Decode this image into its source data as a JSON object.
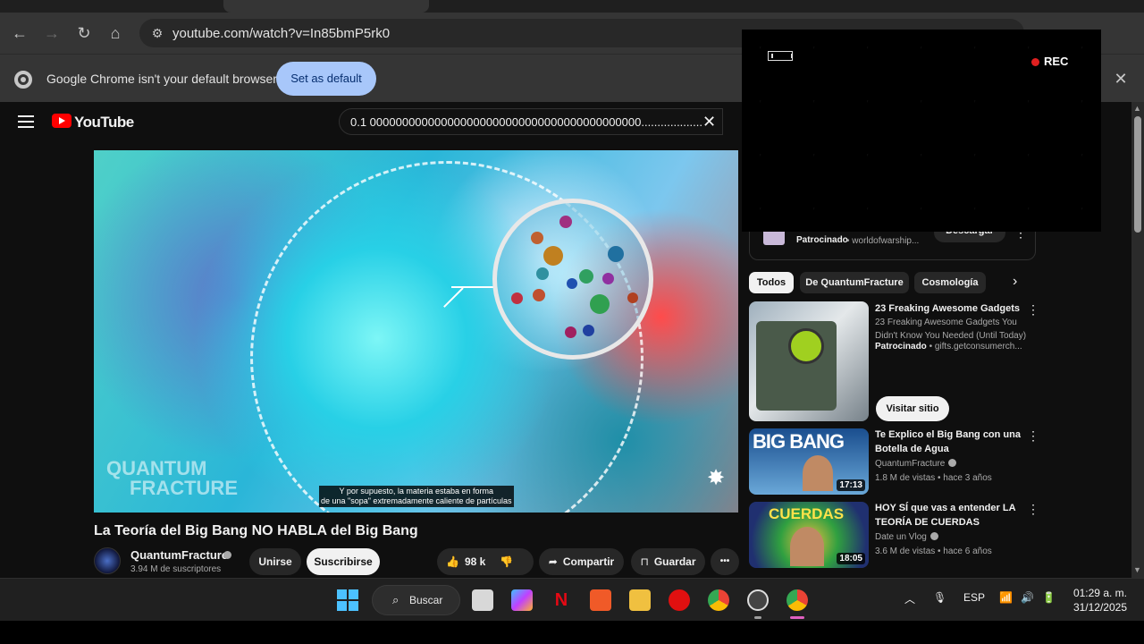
{
  "browser": {
    "url": "youtube.com/watch?v=In85bmP5rk0",
    "infobar_message": "Google Chrome isn't your default browser",
    "set_default_label": "Set as default"
  },
  "youtube": {
    "logo_text": "YouTube",
    "search_query": "0.1 000000000000000000000000000000000000000000........................",
    "video": {
      "title": "La Teoría del Big Bang NO HABLA del Big Bang",
      "subtitle_line1": "Y por supuesto, la materia estaba en forma",
      "subtitle_line2": "de una \"sopa\" extremadamente caliente de partículas",
      "watermark_line1": "QUANTUM",
      "watermark_line2": "FRACTURE"
    },
    "channel": {
      "name": "QuantumFracture",
      "subscribers": "3.94 M de suscriptores",
      "join_label": "Unirse",
      "subscribe_label": "Suscribirse"
    },
    "actions": {
      "likes": "98 k",
      "share_label": "Compartir",
      "save_label": "Guardar",
      "more_label": "•••"
    },
    "sidebar": {
      "sponsor_card": {
        "label": "Patrocinado",
        "domain": "• worldofwarship...",
        "button": "Descargar"
      },
      "chips": [
        "Todos",
        "De QuantumFracture",
        "Cosmología"
      ],
      "ad": {
        "title": "23 Freaking Awesome Gadgets",
        "description": "23 Freaking Awesome Gadgets You Didn't Know You Needed (Until Today)",
        "sponsor": "Patrocinado",
        "domain": "• gifts.getconsumerch...",
        "visit_label": "Visitar sitio"
      },
      "videos": [
        {
          "title": "Te Explico el Big Bang con una Botella de Agua",
          "channel": "QuantumFracture",
          "meta": "1.8 M de vistas • hace 3 años",
          "duration": "17:13",
          "thumb_text": "BIG BANG"
        },
        {
          "title": "HOY SÍ que vas a entender LA TEORÍA DE CUERDAS",
          "channel": "Date un Vlog",
          "meta": "3.6 M de vistas • hace 6 años",
          "duration": "18:05",
          "thumb_text": "CUERDAS"
        }
      ]
    }
  },
  "recording": {
    "label": "REC"
  },
  "taskbar": {
    "search_label": "Buscar",
    "language": "ESP",
    "time": "01:29 a. m.",
    "date": "31/12/2025"
  }
}
